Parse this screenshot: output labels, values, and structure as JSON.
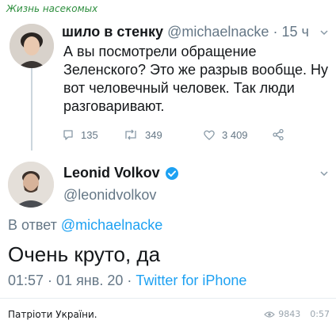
{
  "channel": {
    "title": "Жизнь насекомых"
  },
  "tweet1": {
    "display_name": "шило в стенку",
    "handle": "@michaelnacke",
    "separator": "·",
    "time": "15 ч",
    "text": "А вы посмотрели обращение Зеленского? Это же разрыв вообще. Ну вот человечный человек. Так люди разговаривают.",
    "replies": "135",
    "retweets": "349",
    "likes": "3 409"
  },
  "tweet2": {
    "display_name": "Leonid Volkov",
    "handle": "@leonidvolkov",
    "reply_prefix": "В ответ",
    "reply_mention": "@michaelnacke",
    "text": "Очень круто, да",
    "timestamp": "01:57 · 01 янв. 20 ·",
    "source": "Twitter for iPhone"
  },
  "footer": {
    "caption": "Патріоти України.",
    "views": "9843",
    "time": "0:57"
  },
  "colors": {
    "channel": "#2f8f3f",
    "link": "#1da1f2",
    "muted": "#657786",
    "verified": "#1da1f2"
  }
}
